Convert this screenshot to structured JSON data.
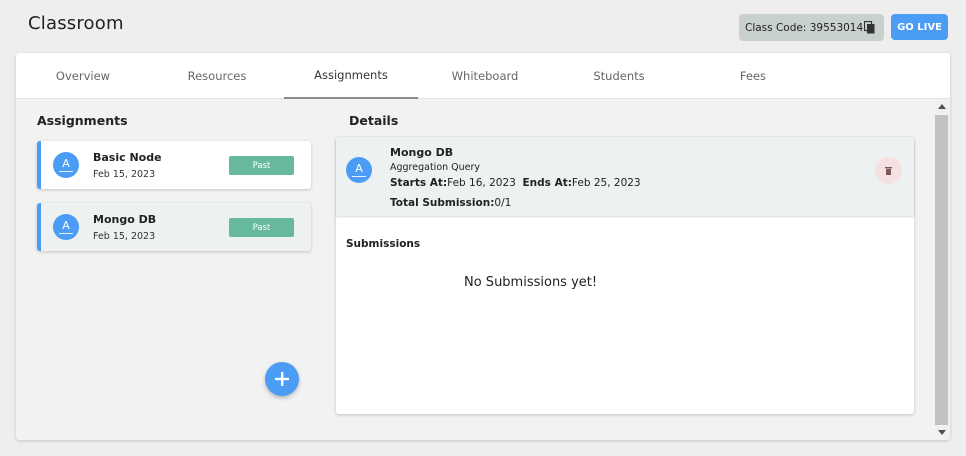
{
  "page": {
    "title": "Classroom"
  },
  "header": {
    "class_code_label": "Class Code: 39553014",
    "copy_icon": "copy-icon",
    "go_live_label": "GO LIVE",
    "accent": "#4b9cf5"
  },
  "tabs": [
    {
      "label": "Overview"
    },
    {
      "label": "Resources"
    },
    {
      "label": "Assignments",
      "active": true
    },
    {
      "label": "Whiteboard"
    },
    {
      "label": "Students"
    },
    {
      "label": "Fees"
    }
  ],
  "assignments": {
    "title": "Assignments",
    "items": [
      {
        "avatar": "A",
        "name": "Basic Node",
        "date": "Feb 15, 2023",
        "status": "Past"
      },
      {
        "avatar": "A",
        "name": "Mongo DB",
        "date": "Feb 15, 2023",
        "status": "Past"
      }
    ],
    "status_color": "#66b99a",
    "add_icon": "plus-icon"
  },
  "details": {
    "title": "Details",
    "avatar": "A",
    "name": "Mongo DB",
    "subtitle": "Aggregation Query",
    "starts_label": "Starts At:",
    "starts_value": "Feb 16, 2023",
    "ends_label": "Ends At:",
    "ends_value": "Feb 25, 2023",
    "total_label": "Total Submission:",
    "total_value": "0/1",
    "delete_icon": "trash-icon"
  },
  "submissions": {
    "title": "Submissions",
    "empty_text": "No Submissions yet!"
  }
}
